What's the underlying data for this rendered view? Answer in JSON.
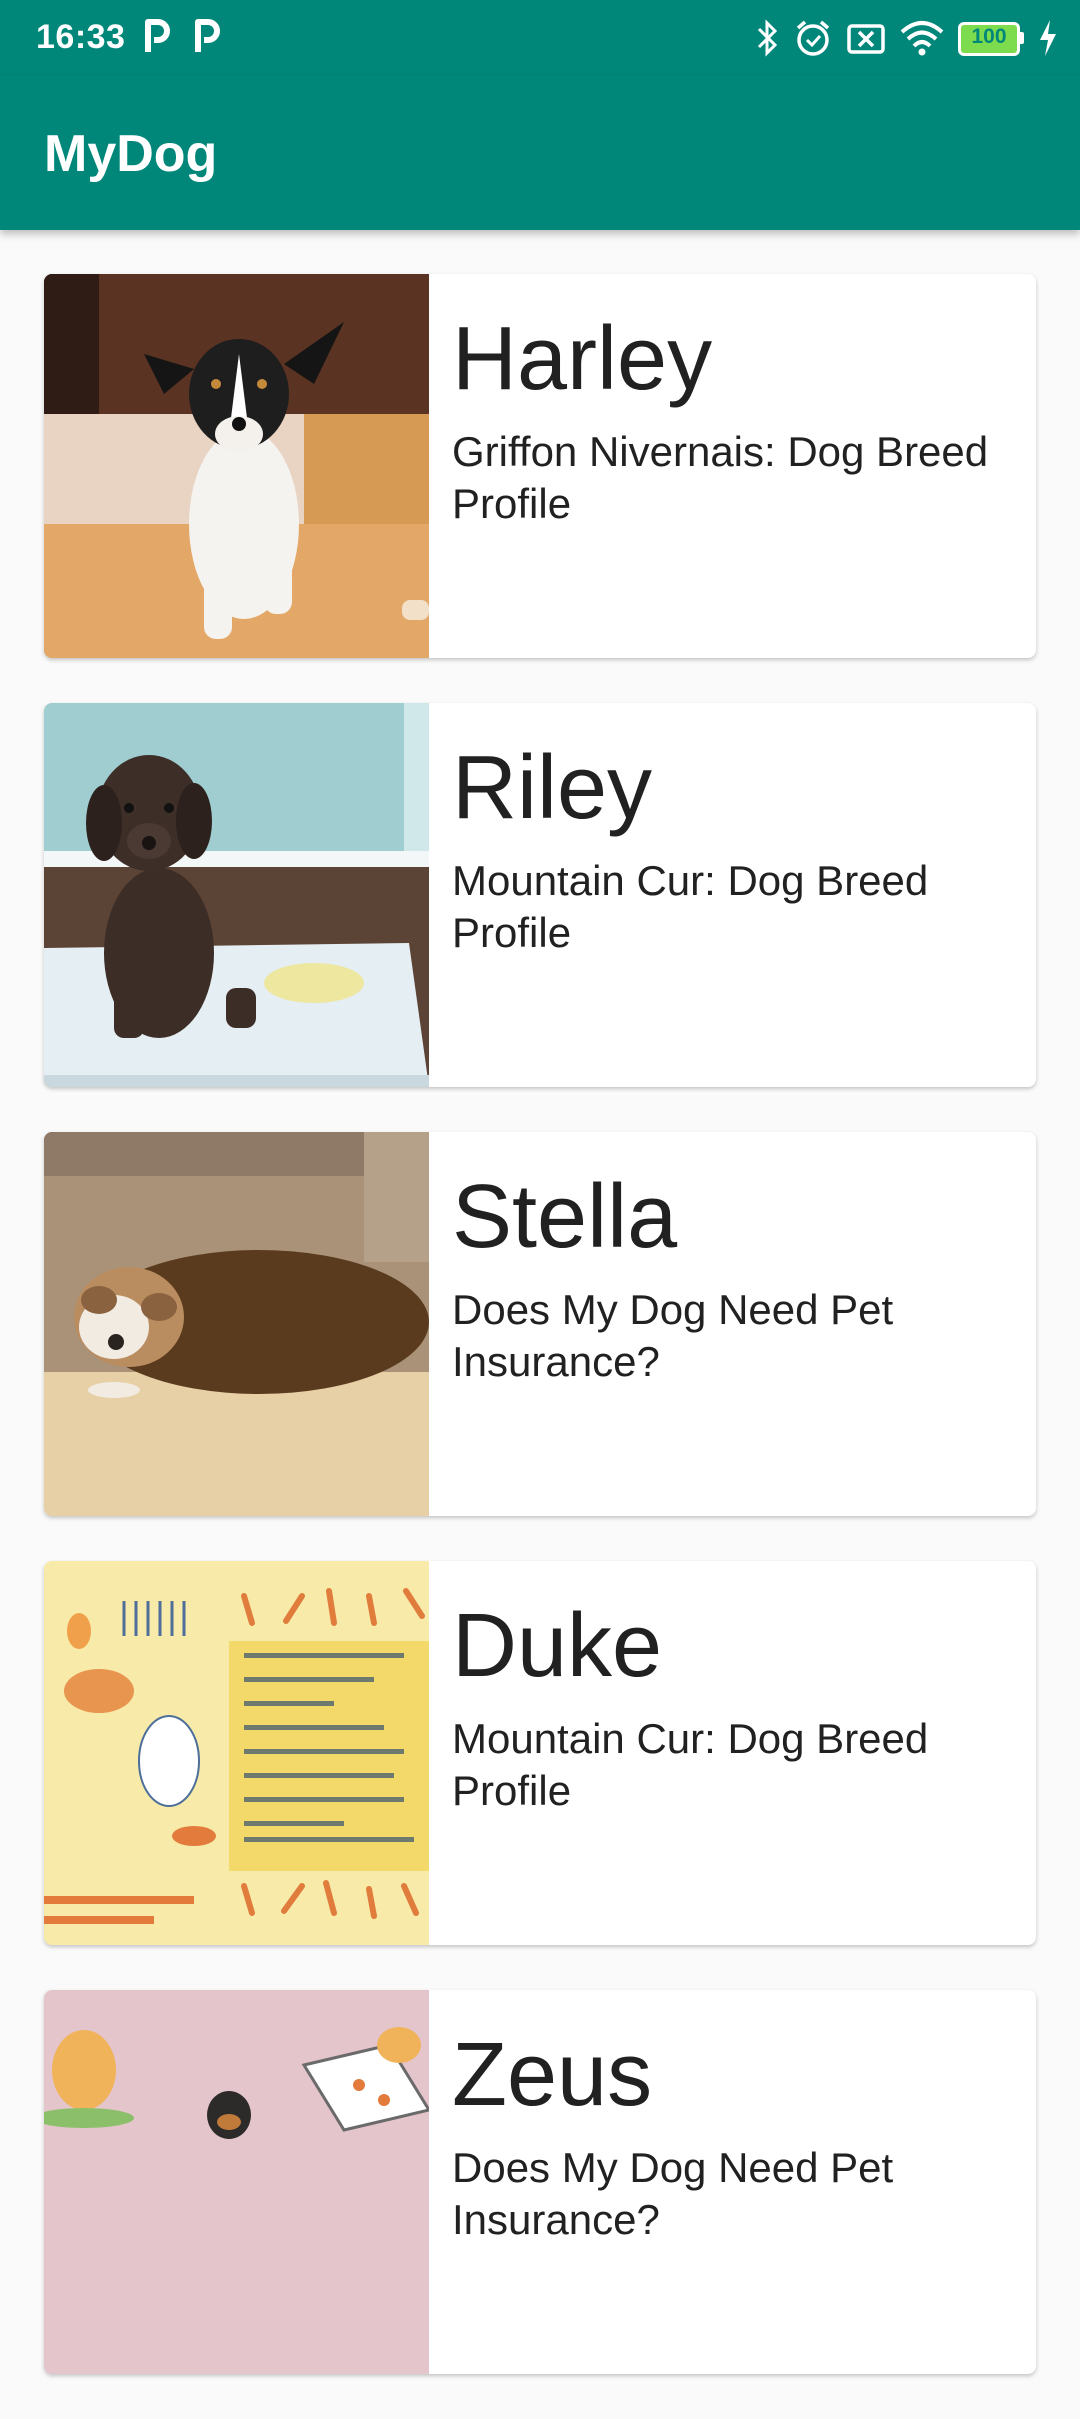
{
  "status_bar": {
    "time": "16:33",
    "notification_icons": [
      "parking-app-icon",
      "parking-app-icon"
    ],
    "indicator_icons": [
      "bluetooth-icon",
      "alarm-icon",
      "sim-off-icon",
      "wifi-icon",
      "battery-icon",
      "charging-icon"
    ],
    "battery_level": "100"
  },
  "app_bar": {
    "title": "MyDog"
  },
  "colors": {
    "primary": "#00877a",
    "background": "#fafafa",
    "card": "#ffffff"
  },
  "dogs": [
    {
      "name": "Harley",
      "description": "Griffon Nivernais: Dog Breed Profile",
      "image": "running-puppy-photo"
    },
    {
      "name": "Riley",
      "description": "Mountain Cur: Dog Breed Profile",
      "image": "chocolate-lab-puppy-photo"
    },
    {
      "name": "Stella",
      "description": "Does My Dog Need Pet Insurance?",
      "image": "bulldog-puppy-photo"
    },
    {
      "name": "Duke",
      "description": "Mountain Cur: Dog Breed Profile",
      "image": "puppy-checklist-infographic"
    },
    {
      "name": "Zeus",
      "description": "Does My Dog Need Pet Insurance?",
      "image": "dog-hazards-illustration"
    }
  ]
}
